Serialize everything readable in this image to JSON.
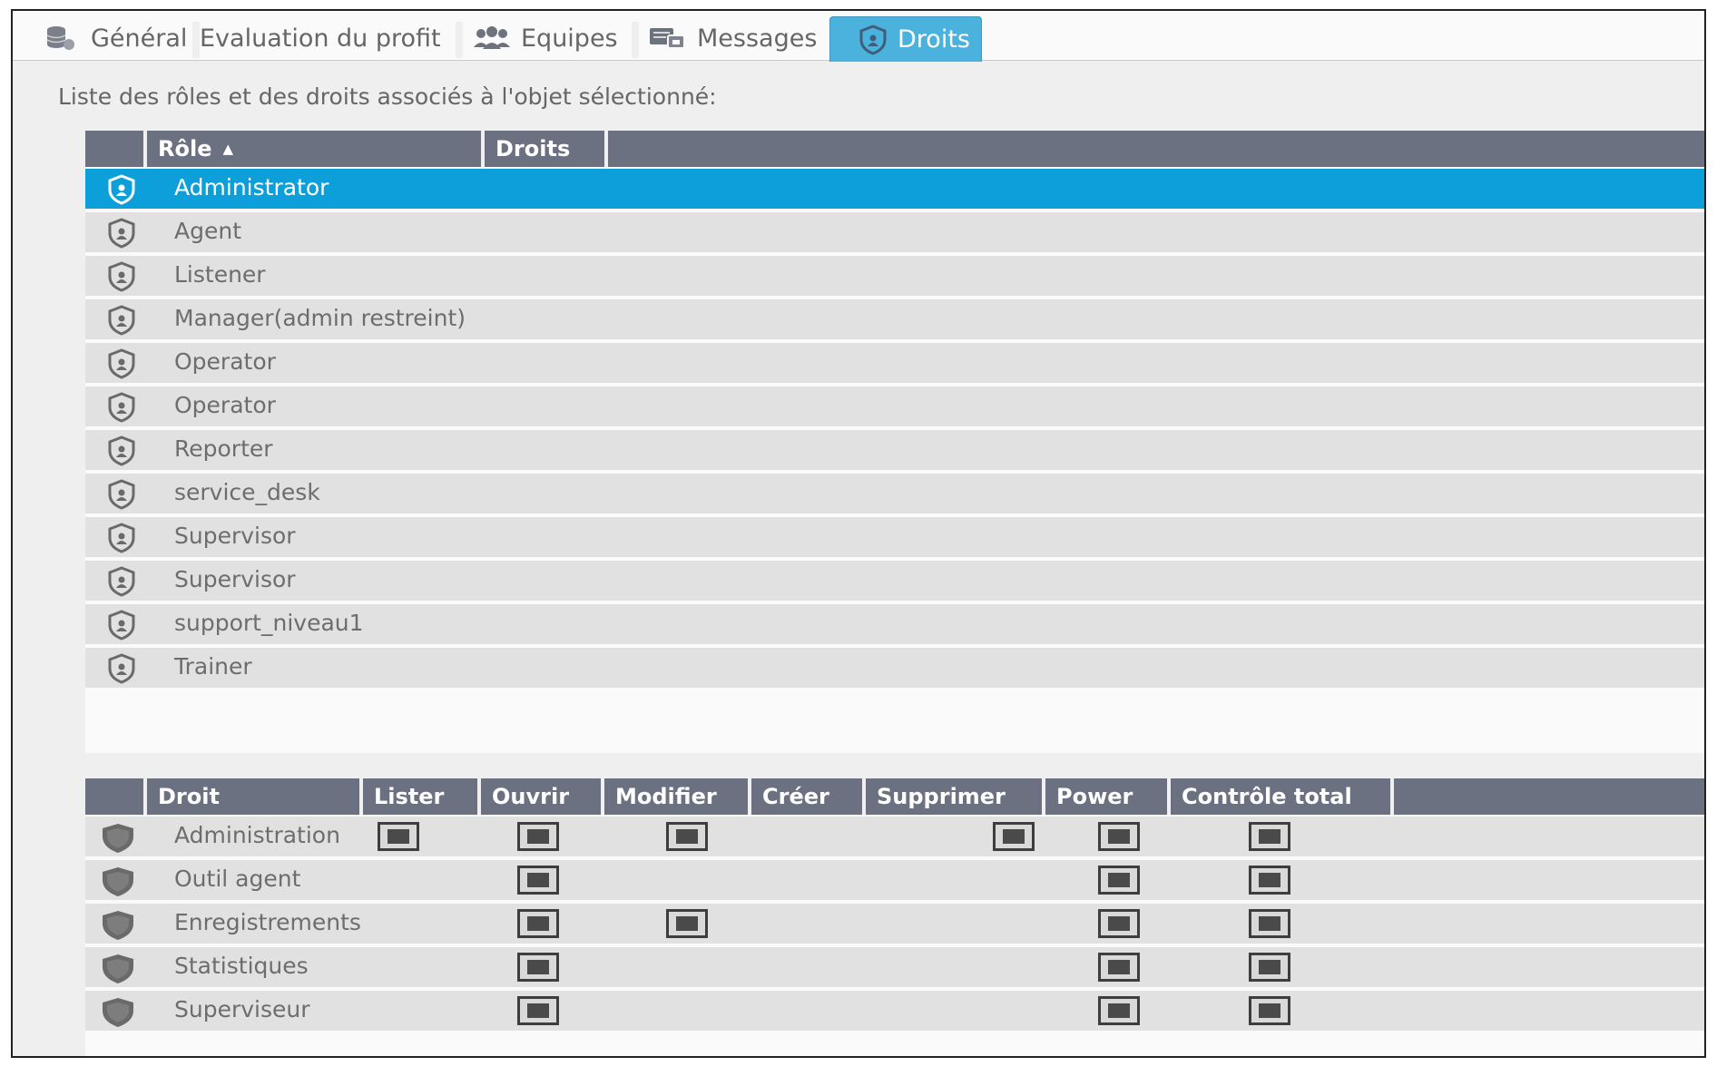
{
  "tabs": [
    {
      "label": "Général",
      "icon": "database-icon",
      "active": false
    },
    {
      "label": "Evaluation du profit",
      "icon": "",
      "active": false
    },
    {
      "label": "Equipes",
      "icon": "users-icon",
      "active": false
    },
    {
      "label": "Messages",
      "icon": "messages-icon",
      "active": false
    },
    {
      "label": "Droits",
      "icon": "shield-icon",
      "active": true
    }
  ],
  "caption": "Liste des rôles et des droits associés à l'objet sélectionné:",
  "roles_table": {
    "headers": {
      "role": "Rôle",
      "rights": "Droits"
    },
    "sort": "ascending",
    "rows": [
      {
        "label": "Administrator",
        "selected": true
      },
      {
        "label": "Agent"
      },
      {
        "label": "Listener"
      },
      {
        "label": "Manager(admin restreint)"
      },
      {
        "label": "Operator"
      },
      {
        "label": "Operator"
      },
      {
        "label": "Reporter"
      },
      {
        "label": "service_desk"
      },
      {
        "label": "Supervisor"
      },
      {
        "label": "Supervisor"
      },
      {
        "label": "support_niveau1"
      },
      {
        "label": "Trainer"
      }
    ]
  },
  "rights_table": {
    "headers": {
      "droit": "Droit",
      "lister": "Lister",
      "ouvrir": "Ouvrir",
      "modifier": "Modifier",
      "creer": "Créer",
      "supprimer": "Supprimer",
      "power": "Power",
      "controle": "Contrôle total"
    },
    "rows": [
      {
        "label": "Administration",
        "lister": true,
        "ouvrir": true,
        "modifier": true,
        "creer": false,
        "supprimer": true,
        "power": true,
        "controle": true
      },
      {
        "label": "Outil agent",
        "lister": false,
        "ouvrir": true,
        "modifier": false,
        "creer": false,
        "supprimer": false,
        "power": true,
        "controle": true
      },
      {
        "label": "Enregistrements",
        "lister": false,
        "ouvrir": true,
        "modifier": true,
        "creer": false,
        "supprimer": false,
        "power": true,
        "controle": true
      },
      {
        "label": "Statistiques",
        "lister": false,
        "ouvrir": true,
        "modifier": false,
        "creer": false,
        "supprimer": false,
        "power": true,
        "controle": true
      },
      {
        "label": "Superviseur",
        "lister": false,
        "ouvrir": true,
        "modifier": false,
        "creer": false,
        "supprimer": false,
        "power": true,
        "controle": true
      }
    ]
  },
  "colors": {
    "accent": "#0c9fda",
    "tab_active": "#4bb2de",
    "header_bg": "#6b7180",
    "row_bg": "#e1e1e1"
  }
}
